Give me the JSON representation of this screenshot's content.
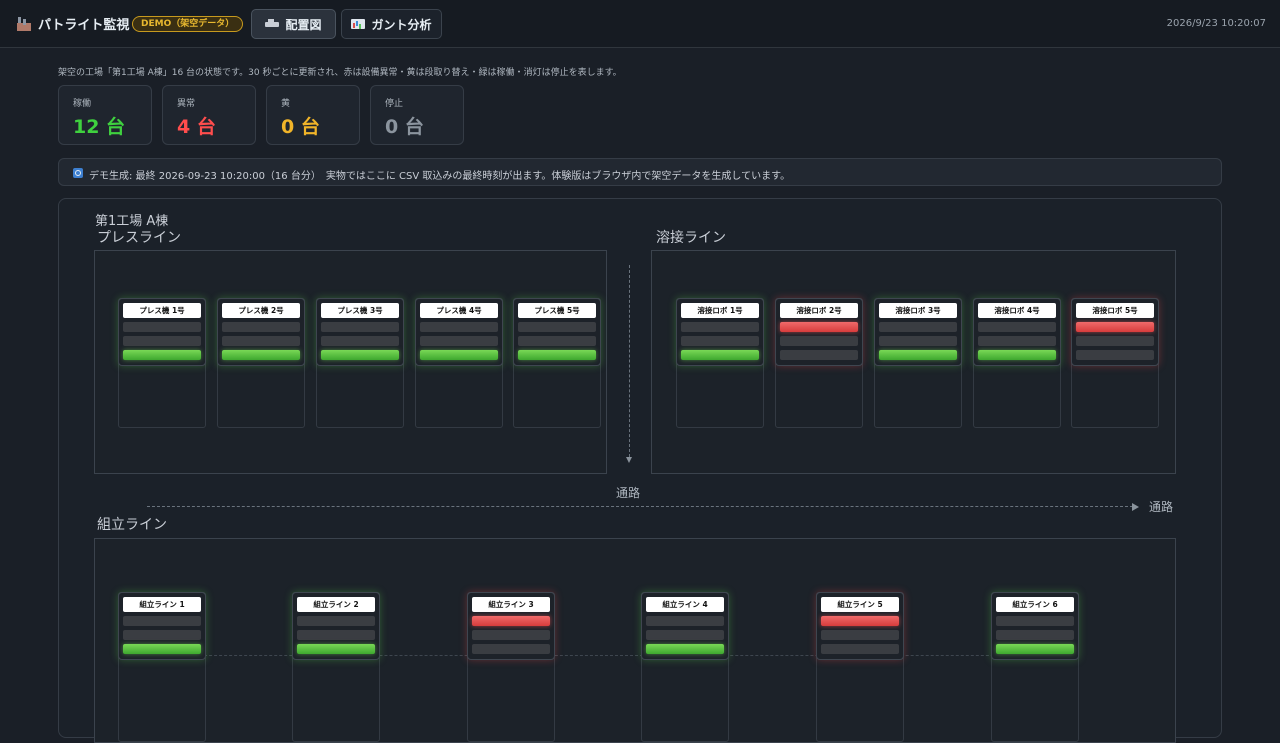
{
  "app": {
    "title": "パトライト監視",
    "demo_badge": "DEMO（架空データ）",
    "clock": "2026/9/23 10:20:07"
  },
  "tabs": [
    {
      "label": "配置図",
      "icon": "layout-icon",
      "active": true
    },
    {
      "label": "ガント分析",
      "icon": "gantt-chart-icon",
      "active": false
    }
  ],
  "description": "架空の工場「第1工場 A棟」16 台の状態です。30 秒ごとに更新され、赤は設備異常・黄は段取り替え・緑は稼働・消灯は停止を表します。",
  "stats": [
    {
      "label": "稼働",
      "value": "12 台",
      "color": "#3fd13f"
    },
    {
      "label": "異常",
      "value": "4 台",
      "color": "#ff4d4d"
    },
    {
      "label": "黄",
      "value": "0 台",
      "color": "#f0b429"
    },
    {
      "label": "停止",
      "value": "0 台",
      "color": "#8b949e"
    }
  ],
  "info": "デモ生成: 最終 2026-09-23 10:20:00（16 台分）　実物ではここに CSV 取込みの最終時刻が出ます。体験版はブラウザ内で架空データを生成しています。",
  "map": {
    "plant": "第1工場 A棟",
    "aisle_label": "通路",
    "aisle_label_2": "通路",
    "sections": {
      "press": {
        "title": "プレスライン",
        "machines": [
          {
            "name": "プレス機 1号",
            "state": "green"
          },
          {
            "name": "プレス機 2号",
            "state": "green"
          },
          {
            "name": "プレス機 3号",
            "state": "green"
          },
          {
            "name": "プレス機 4号",
            "state": "green"
          },
          {
            "name": "プレス機 5号",
            "state": "green"
          }
        ]
      },
      "weld": {
        "title": "溶接ライン",
        "machines": [
          {
            "name": "溶接ロボ 1号",
            "state": "green"
          },
          {
            "name": "溶接ロボ 2号",
            "state": "red"
          },
          {
            "name": "溶接ロボ 3号",
            "state": "green"
          },
          {
            "name": "溶接ロボ 4号",
            "state": "green"
          },
          {
            "name": "溶接ロボ 5号",
            "state": "red"
          }
        ]
      },
      "assembly": {
        "title": "組立ライン",
        "machines": [
          {
            "name": "組立ライン 1",
            "state": "green"
          },
          {
            "name": "組立ライン 2",
            "state": "green"
          },
          {
            "name": "組立ライン 3",
            "state": "red"
          },
          {
            "name": "組立ライン 4",
            "state": "green"
          },
          {
            "name": "組立ライン 5",
            "state": "red"
          },
          {
            "name": "組立ライン 6",
            "state": "green"
          }
        ]
      }
    }
  }
}
